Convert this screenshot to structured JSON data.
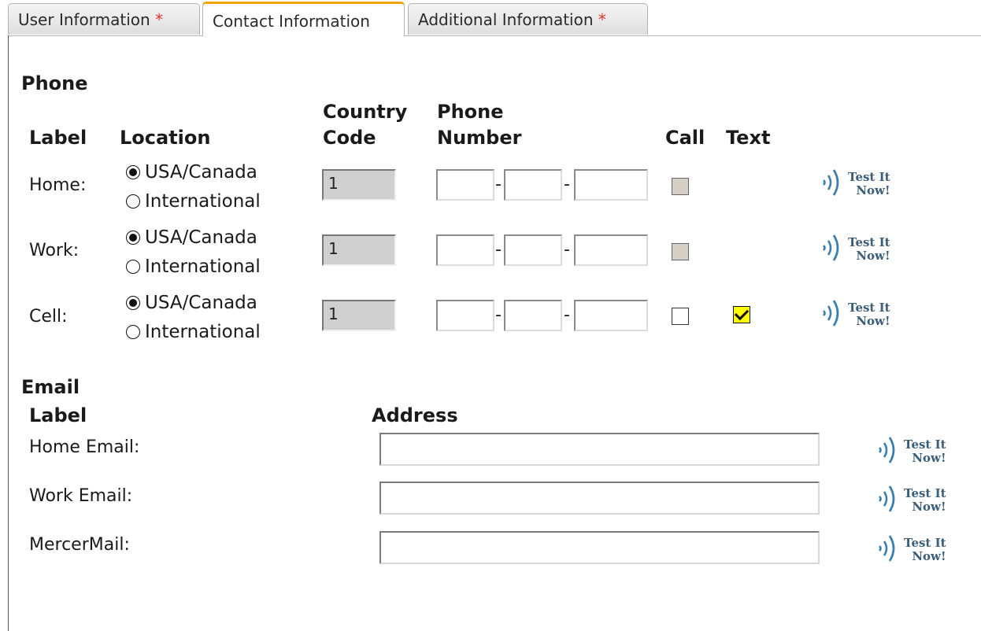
{
  "tabs": [
    {
      "label": "User Information",
      "required_mark": "*"
    },
    {
      "label": "Contact Information"
    },
    {
      "label": "Additional Information",
      "required_mark": "*"
    }
  ],
  "phone": {
    "section_title": "Phone",
    "headers": {
      "label": "Label",
      "location": "Location",
      "country_code_line1": "Country",
      "country_code_line2": "Code",
      "phone_line1": "Phone",
      "phone_line2": "Number",
      "call": "Call",
      "text": "Text"
    },
    "location_options": [
      "USA/Canada",
      "International"
    ],
    "rows": [
      {
        "label": "Home:",
        "selected_location": "USA/Canada",
        "country_code": "1",
        "call_checked": false,
        "call_disabled": true,
        "text_checked": null
      },
      {
        "label": "Work:",
        "selected_location": "USA/Canada",
        "country_code": "1",
        "call_checked": false,
        "call_disabled": true,
        "text_checked": null
      },
      {
        "label": "Cell:",
        "selected_location": "USA/Canada",
        "country_code": "1",
        "call_checked": false,
        "call_disabled": false,
        "text_checked": true
      }
    ],
    "separator": "-"
  },
  "email": {
    "section_title": "Email",
    "headers": {
      "label": "Label",
      "address": "Address"
    },
    "rows": [
      {
        "label": "Home Email:",
        "value": ""
      },
      {
        "label": "Work Email:",
        "value": ""
      },
      {
        "label": "MercerMail:",
        "value": ""
      }
    ]
  },
  "test_button": {
    "line1": "Test It",
    "line2": "Now!",
    "icon": "sound-waves-icon",
    "color": "#3a5d7a"
  },
  "colors": {
    "active_tab_accent": "#f0a30a",
    "required_star": "#e0332b",
    "text_checkbox_highlight": "#ffff00"
  }
}
